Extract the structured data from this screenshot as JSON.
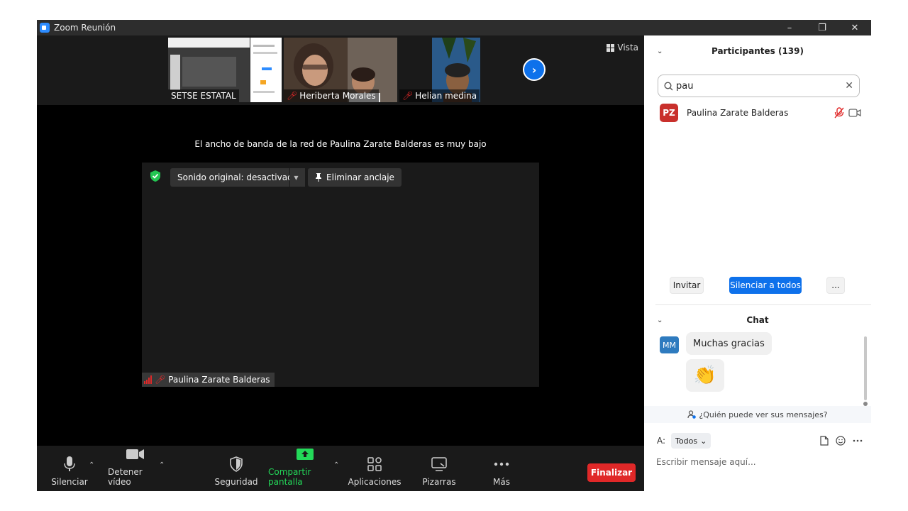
{
  "window": {
    "title": "Zoom Reunión",
    "controls": [
      "–",
      "❐",
      "✕"
    ]
  },
  "gallery": {
    "thumbs": [
      {
        "name": "SETSE ESTATAL",
        "muted": false
      },
      {
        "name": "Heriberta Morales",
        "muted": true
      },
      {
        "name": "Helian medina",
        "muted": true
      }
    ],
    "view_label": "Vista"
  },
  "main": {
    "bandwidth_notice": "El ancho de banda de la red de Paulina Zarate Balderas es muy bajo",
    "original_sound": "Sonido original: desactivado",
    "unpin": "Eliminar anclaje",
    "speaker_name": "Paulina Zarate Balderas"
  },
  "toolbar": {
    "mute": "Silenciar",
    "stop_video": "Detener vídeo",
    "security": "Seguridad",
    "share": "Compartir pantalla",
    "apps": "Aplicaciones",
    "whiteboards": "Pizarras",
    "more": "Más",
    "end": "Finalizar"
  },
  "participants": {
    "title": "Participantes (139)",
    "search_value": "pau",
    "list": [
      {
        "initials": "PZ",
        "name": "Paulina Zarate Balderas",
        "avatar_color": "#c9302c"
      }
    ],
    "invite": "Invitar",
    "mute_all": "Silenciar a todos",
    "more": "..."
  },
  "chat": {
    "title": "Chat",
    "messages": [
      {
        "initials": "MM",
        "text": "Muchas gracias",
        "emoji": "👏"
      }
    ],
    "who_can_see": "¿Quién puede ver sus mensajes?",
    "to_label": "A:",
    "to_value": "Todos",
    "placeholder": "Escribir mensaje aquí..."
  },
  "colors": {
    "accent": "#0e71eb",
    "end": "#e02828",
    "share": "#23d959",
    "muted": "#e02828"
  }
}
